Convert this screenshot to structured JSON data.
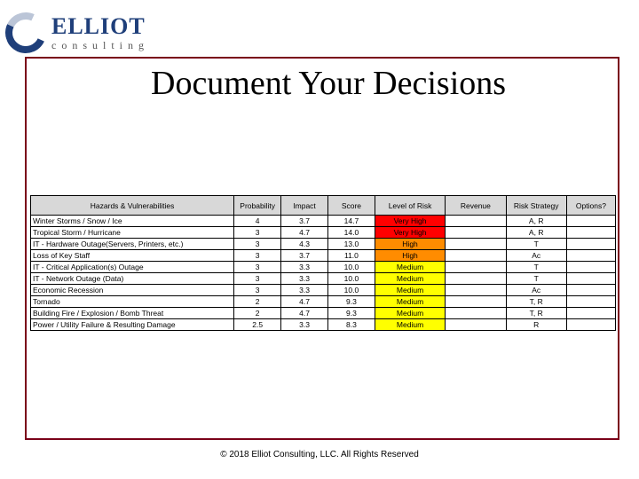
{
  "logo": {
    "main": "ELLIOT",
    "sub": "consulting"
  },
  "title": "Document Your Decisions",
  "table": {
    "headers": [
      "Hazards & Vulnerabilities",
      "Probability",
      "Impact",
      "Score",
      "Level of Risk",
      "Revenue",
      "Risk Strategy",
      "Options?"
    ],
    "rows": [
      {
        "hazard": "Winter Storms / Snow / Ice",
        "prob": "4",
        "impact": "3.7",
        "score": "14.7",
        "risk": "Very High",
        "risk_class": "very-high",
        "strategy": "A, R"
      },
      {
        "hazard": "Tropical Storm / Hurricane",
        "prob": "3",
        "impact": "4.7",
        "score": "14.0",
        "risk": "Very High",
        "risk_class": "very-high",
        "strategy": "A, R"
      },
      {
        "hazard": "IT - Hardware Outage(Servers, Printers, etc.)",
        "prob": "3",
        "impact": "4.3",
        "score": "13.0",
        "risk": "High",
        "risk_class": "high",
        "strategy": "T"
      },
      {
        "hazard": "Loss of Key Staff",
        "prob": "3",
        "impact": "3.7",
        "score": "11.0",
        "risk": "High",
        "risk_class": "high",
        "strategy": "Ac"
      },
      {
        "hazard": "IT - Critical Application(s) Outage",
        "prob": "3",
        "impact": "3.3",
        "score": "10.0",
        "risk": "Medium",
        "risk_class": "medium",
        "strategy": "T"
      },
      {
        "hazard": "IT - Network Outage (Data)",
        "prob": "3",
        "impact": "3.3",
        "score": "10.0",
        "risk": "Medium",
        "risk_class": "medium",
        "strategy": "T"
      },
      {
        "hazard": "Economic Recession",
        "prob": "3",
        "impact": "3.3",
        "score": "10.0",
        "risk": "Medium",
        "risk_class": "medium",
        "strategy": "Ac"
      },
      {
        "hazard": "Tornado",
        "prob": "2",
        "impact": "4.7",
        "score": "9.3",
        "risk": "Medium",
        "risk_class": "medium",
        "strategy": "T, R"
      },
      {
        "hazard": "Building Fire / Explosion / Bomb Threat",
        "prob": "2",
        "impact": "4.7",
        "score": "9.3",
        "risk": "Medium",
        "risk_class": "medium",
        "strategy": "T, R"
      },
      {
        "hazard": "Power / Utility Failure & Resulting Damage",
        "prob": "2.5",
        "impact": "3.3",
        "score": "8.3",
        "risk": "Medium",
        "risk_class": "medium",
        "strategy": "R"
      }
    ]
  },
  "footer": "© 2018 Elliot Consulting, LLC. All Rights Reserved"
}
